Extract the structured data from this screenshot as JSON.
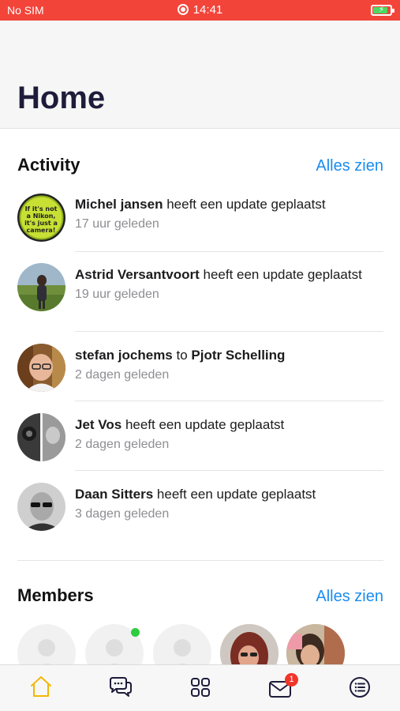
{
  "status_bar": {
    "carrier": "No SIM",
    "time": "14:41",
    "battery_level": 0.85,
    "battery_color": "#4cd964",
    "bar_color": "#f3443a"
  },
  "header": {
    "title": "Home"
  },
  "activity": {
    "title": "Activity",
    "see_all": "Alles zien",
    "items": [
      {
        "name": "Michel jansen",
        "action": " heeft een update geplaatst",
        "time": "17 uur geleden",
        "avatar": "badge-button-avatar"
      },
      {
        "name": "Astrid Versantvoort",
        "action": " heeft een update geplaatst",
        "time": "19 uur geleden",
        "avatar": "field-photo-avatar"
      },
      {
        "name": "stefan jochems",
        "action": " to ",
        "target": "Pjotr Schelling",
        "time": "2 dagen geleden",
        "avatar": "man-glasses-avatar"
      },
      {
        "name": "Jet Vos",
        "action": " heeft een update geplaatst",
        "time": "2 dagen geleden",
        "avatar": "bw-collage-avatar"
      },
      {
        "name": "Daan Sitters",
        "action": " heeft een update geplaatst",
        "time": "3 dagen geleden",
        "avatar": "bw-sunglasses-avatar"
      }
    ]
  },
  "members": {
    "title": "Members",
    "see_all": "Alles zien",
    "items": [
      {
        "type": "placeholder",
        "online": false
      },
      {
        "type": "placeholder",
        "online": true
      },
      {
        "type": "placeholder",
        "online": false
      },
      {
        "type": "photo",
        "online": false
      },
      {
        "type": "photo",
        "online": false
      }
    ]
  },
  "tabbar": {
    "tabs": [
      "home-icon",
      "chat-icon",
      "groups-icon",
      "messages-icon",
      "menu-icon"
    ],
    "active_color": "#f2b705",
    "icon_color": "#1e1c3a",
    "messages_badge": "1"
  },
  "colors": {
    "accent": "#1a8cf0",
    "title": "#1e1c3a",
    "online": "#2ecc40"
  }
}
